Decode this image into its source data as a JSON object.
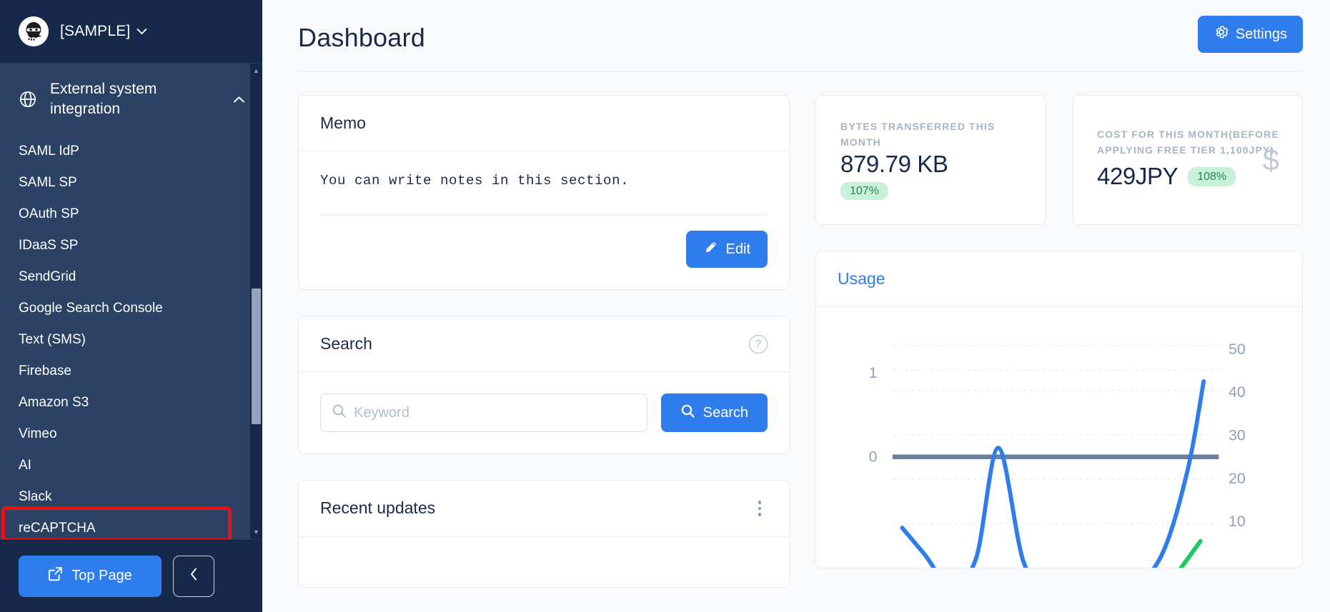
{
  "sidebar": {
    "brand": {
      "name": "[SAMPLE]",
      "caret": "chevron-down",
      "logo": "ninja-logo"
    },
    "group": {
      "label": "External system integration",
      "icon": "globe-icon",
      "expanded_icon": "chevron-up"
    },
    "items": [
      {
        "label": "SAML IdP",
        "highlighted": false
      },
      {
        "label": "SAML SP",
        "highlighted": false
      },
      {
        "label": "OAuth SP",
        "highlighted": false
      },
      {
        "label": "IDaaS SP",
        "highlighted": false
      },
      {
        "label": "SendGrid",
        "highlighted": false
      },
      {
        "label": "Google Search Console",
        "highlighted": false
      },
      {
        "label": "Text (SMS)",
        "highlighted": false
      },
      {
        "label": "Firebase",
        "highlighted": false
      },
      {
        "label": "Amazon S3",
        "highlighted": false
      },
      {
        "label": "Vimeo",
        "highlighted": false
      },
      {
        "label": "AI",
        "highlighted": true
      },
      {
        "label": "Slack",
        "highlighted": false
      },
      {
        "label": "reCAPTCHA",
        "highlighted": false
      }
    ],
    "footer": {
      "top_page_label": "Top Page",
      "top_page_icon": "external-link-icon",
      "collapse_icon": "chevron-left-icon"
    },
    "scrollbar": {
      "up_icon": "caret-up-icon",
      "down_icon": "caret-down-icon"
    },
    "annotation": {
      "target": "AI",
      "color": "#ee1111"
    }
  },
  "header": {
    "title": "Dashboard",
    "settings_label": "Settings",
    "settings_icon": "gear-icon"
  },
  "memo": {
    "title": "Memo",
    "body": "You can write notes in this section.",
    "edit_label": "Edit",
    "edit_icon": "pencil-icon"
  },
  "search": {
    "title": "Search",
    "help_icon": "question-circle-icon",
    "placeholder": "Keyword",
    "value": "",
    "button_label": "Search",
    "button_icon": "magnifier-icon",
    "input_icon": "magnifier-icon"
  },
  "recent_updates": {
    "title": "Recent updates",
    "menu_icon": "kebab-menu-icon"
  },
  "stats": [
    {
      "label": "BYTES TRANSFERRED THIS MONTH",
      "value": "879.79 KB",
      "badge": "107%",
      "badge_color": "#208c50",
      "badge_bg": "#c9f0da",
      "deco_icon": ""
    },
    {
      "label": "COST FOR THIS MONTH(BEFORE APPLYING FREE TIER 1,100JPY)",
      "value": "429JPY",
      "badge": "108%",
      "badge_color": "#208c50",
      "badge_bg": "#c9f0da",
      "deco_icon": "$"
    }
  ],
  "usage": {
    "title": "Usage"
  },
  "chart_data": {
    "type": "line",
    "title": "Usage",
    "xlabel": "",
    "ylabel": "",
    "grid": true,
    "legend": false,
    "left_axis": {
      "ticks": [
        0,
        1
      ],
      "ylim": [
        0,
        1
      ],
      "tick_labels": [
        "0",
        "1"
      ],
      "color": "#8fa0b8"
    },
    "right_axis": {
      "ticks": [
        10,
        20,
        30,
        40,
        50
      ],
      "ylim": [
        0,
        52
      ],
      "tick_labels": [
        "10",
        "20",
        "30",
        "40",
        "50"
      ],
      "color": "#8fa0b8"
    },
    "series": [
      {
        "name": "baseline",
        "color": "#6b7f9e",
        "style": "solid-thick-flat",
        "axis": "right",
        "values": [
          25,
          25,
          25,
          25,
          25,
          25,
          25,
          25,
          25,
          25,
          25
        ]
      },
      {
        "name": "usage",
        "color": "#2f7ced",
        "style": "curve",
        "axis": "right",
        "x": [
          0.03,
          0.1,
          0.18,
          0.26,
          0.33,
          0.41,
          0.5,
          0.62,
          0.74,
          0.84,
          0.92,
          0.97
        ],
        "values": [
          9,
          3,
          -4,
          2,
          27,
          1,
          -6,
          -6,
          -5,
          3,
          22,
          42
        ]
      },
      {
        "name": "secondary",
        "color": "#18c964",
        "style": "line",
        "axis": "right",
        "x": [
          0.88,
          0.96
        ],
        "values": [
          -2,
          6
        ]
      }
    ],
    "gridline_values": [
      10,
      20,
      30,
      40,
      50
    ],
    "gridline_style": "dotted",
    "gridline_color": "#e5ecf7"
  }
}
